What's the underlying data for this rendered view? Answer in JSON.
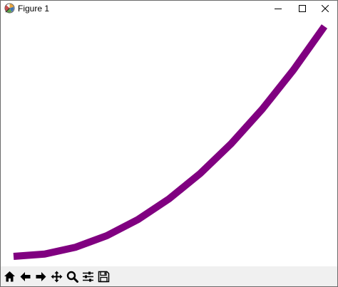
{
  "window": {
    "title": "Figure 1"
  },
  "icons": {
    "app": "matplotlib-icon",
    "minimize": "minimize-icon",
    "maximize": "maximize-icon",
    "close": "close-icon"
  },
  "toolbar": {
    "buttons": [
      "home-icon",
      "back-arrow-icon",
      "forward-arrow-icon",
      "pan-icon",
      "zoom-icon",
      "configure-subplots-icon",
      "save-icon"
    ]
  },
  "chart_data": {
    "type": "line",
    "x": [
      0,
      1,
      2,
      3,
      4,
      5,
      6,
      7,
      8,
      9,
      10
    ],
    "series": [
      {
        "values": [
          0,
          1,
          4,
          9,
          16,
          25,
          36,
          49,
          64,
          81,
          100
        ]
      }
    ],
    "color": "#800080",
    "grid": false,
    "axes_visible": false
  }
}
